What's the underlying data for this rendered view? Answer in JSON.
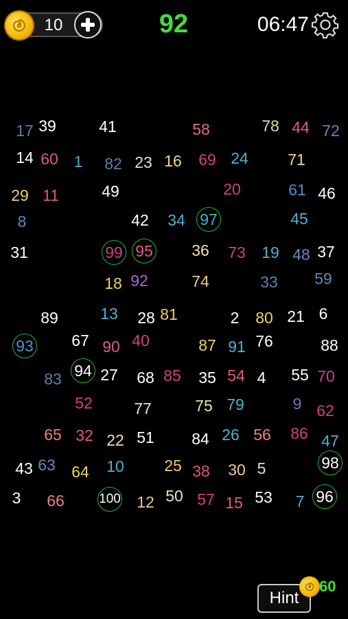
{
  "header": {
    "coins": "10",
    "target_number": "92",
    "timer": "06:47",
    "icons": {
      "coin": "coin-icon",
      "add": "plus-icon",
      "settings": "gear-icon"
    }
  },
  "board": {
    "numbers": [
      {
        "v": "17",
        "c": "#5b7fa8"
      },
      {
        "v": "39",
        "c": "#ffffff"
      },
      {
        "v": "41",
        "c": "#ffffff"
      },
      {
        "v": "58",
        "c": "#e06b7a"
      },
      {
        "v": "78",
        "c": "#e8d8a8"
      },
      {
        "v": "44",
        "c": "#e05a8a"
      },
      {
        "v": "72",
        "c": "#5b8cc0"
      },
      {
        "v": "14",
        "c": "#ffffff"
      },
      {
        "v": "60",
        "c": "#e05a72"
      },
      {
        "v": "1",
        "c": "#4fb0d0"
      },
      {
        "v": "82",
        "c": "#5b7fa8"
      },
      {
        "v": "23",
        "c": "#f0e0b0"
      },
      {
        "v": "16",
        "c": "#f0d890"
      },
      {
        "v": "69",
        "c": "#d04080"
      },
      {
        "v": "24",
        "c": "#4fb0d0"
      },
      {
        "v": "71",
        "c": "#f0d890"
      },
      {
        "v": "29",
        "c": "#f0d060"
      },
      {
        "v": "11",
        "c": "#e05a72"
      },
      {
        "v": "49",
        "c": "#ffffff"
      },
      {
        "v": "20",
        "c": "#d04080"
      },
      {
        "v": "61",
        "c": "#4f90d0"
      },
      {
        "v": "46",
        "c": "#ffffff"
      },
      {
        "v": "8",
        "c": "#5b8cc0"
      },
      {
        "v": "42",
        "c": "#ffffff"
      },
      {
        "v": "34",
        "c": "#4fb0d0"
      },
      {
        "v": "97",
        "c": "#4fb0d0",
        "found": true
      },
      {
        "v": "45",
        "c": "#4fb0d0"
      },
      {
        "v": "31",
        "c": "#ffffff"
      },
      {
        "v": "99",
        "c": "#d04080",
        "found": true
      },
      {
        "v": "95",
        "c": "#e05a8a",
        "found": true
      },
      {
        "v": "36",
        "c": "#f0e0b0"
      },
      {
        "v": "73",
        "c": "#d04080"
      },
      {
        "v": "19",
        "c": "#4fb0d0"
      },
      {
        "v": "48",
        "c": "#5b8cc0"
      },
      {
        "v": "37",
        "c": "#ffffff"
      },
      {
        "v": "18",
        "c": "#f0d060"
      },
      {
        "v": "92",
        "c": "#a868d0"
      },
      {
        "v": "74",
        "c": "#f0c890"
      },
      {
        "v": "33",
        "c": "#5b7fa8"
      },
      {
        "v": "59",
        "c": "#5b8cc0"
      },
      {
        "v": "89",
        "c": "#ffffff"
      },
      {
        "v": "13",
        "c": "#4fb0d0"
      },
      {
        "v": "28",
        "c": "#ffffff"
      },
      {
        "v": "81",
        "c": "#f0d060"
      },
      {
        "v": "2",
        "c": "#ffffff"
      },
      {
        "v": "80",
        "c": "#f0d060"
      },
      {
        "v": "21",
        "c": "#ffffff"
      },
      {
        "v": "6",
        "c": "#ffffff"
      },
      {
        "v": "93",
        "c": "#4f90d0",
        "found": true
      },
      {
        "v": "67",
        "c": "#ffffff"
      },
      {
        "v": "90",
        "c": "#e05a8a"
      },
      {
        "v": "40",
        "c": "#d04080"
      },
      {
        "v": "87",
        "c": "#f0d060"
      },
      {
        "v": "91",
        "c": "#4fb0d0"
      },
      {
        "v": "76",
        "c": "#ffffff"
      },
      {
        "v": "88",
        "c": "#ffffff"
      },
      {
        "v": "83",
        "c": "#5b7fa8"
      },
      {
        "v": "94",
        "c": "#ffffff",
        "found": true
      },
      {
        "v": "27",
        "c": "#ffffff"
      },
      {
        "v": "68",
        "c": "#ffffff"
      },
      {
        "v": "85",
        "c": "#d04080"
      },
      {
        "v": "35",
        "c": "#ffffff"
      },
      {
        "v": "54",
        "c": "#e05a8a"
      },
      {
        "v": "4",
        "c": "#ffffff"
      },
      {
        "v": "55",
        "c": "#ffffff"
      },
      {
        "v": "70",
        "c": "#d04080"
      },
      {
        "v": "52",
        "c": "#d04080"
      },
      {
        "v": "77",
        "c": "#f0e0b0"
      },
      {
        "v": "75",
        "c": "#f0e0b0"
      },
      {
        "v": "79",
        "c": "#4fb0d0"
      },
      {
        "v": "9",
        "c": "#8868c0"
      },
      {
        "v": "62",
        "c": "#d04080"
      },
      {
        "v": "65",
        "c": "#f08080"
      },
      {
        "v": "32",
        "c": "#e05a72"
      },
      {
        "v": "22",
        "c": "#f0e0b0"
      },
      {
        "v": "51",
        "c": "#ffffff"
      },
      {
        "v": "84",
        "c": "#ffffff"
      },
      {
        "v": "26",
        "c": "#4fb0d0"
      },
      {
        "v": "56",
        "c": "#f08080"
      },
      {
        "v": "86",
        "c": "#d04080"
      },
      {
        "v": "47",
        "c": "#4fb0d0"
      },
      {
        "v": "43",
        "c": "#ffffff"
      },
      {
        "v": "63",
        "c": "#5b8cc0"
      },
      {
        "v": "64",
        "c": "#f0d060"
      },
      {
        "v": "10",
        "c": "#4fb0d0"
      },
      {
        "v": "25",
        "c": "#f0d060"
      },
      {
        "v": "38",
        "c": "#e05a72"
      },
      {
        "v": "30",
        "c": "#f0c890"
      },
      {
        "v": "5",
        "c": "#f0e0b0"
      },
      {
        "v": "98",
        "c": "#ffffff",
        "found": true
      },
      {
        "v": "3",
        "c": "#ffffff"
      },
      {
        "v": "66",
        "c": "#f08080"
      },
      {
        "v": "100",
        "c": "#ffffff",
        "found": true
      },
      {
        "v": "12",
        "c": "#f0c890"
      },
      {
        "v": "50",
        "c": "#f0e0b0"
      },
      {
        "v": "57",
        "c": "#d04080"
      },
      {
        "v": "15",
        "c": "#e05a8a"
      },
      {
        "v": "53",
        "c": "#ffffff"
      },
      {
        "v": "7",
        "c": "#4fb0d0"
      },
      {
        "v": "96",
        "c": "#ffffff",
        "found": true
      }
    ]
  },
  "hint": {
    "label": "Hint",
    "cost": "60"
  }
}
